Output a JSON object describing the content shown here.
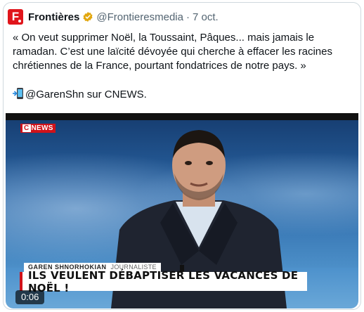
{
  "tweet": {
    "author_name": "Frontières",
    "handle": "@Frontieresmedia",
    "separator": "·",
    "date": "7 oct.",
    "logo_letter": "F",
    "text_line1": "« On veut supprimer Noël, la Toussaint, Pâques... mais jamais le ramadan. C’est une laïcité dévoyée qui cherche à effacer les racines chrétiennes de la France, pourtant fondatrices de notre pays. »",
    "text_line2": "@GarenShn sur CNEWS.",
    "accent_color": "#e0151b",
    "verified_color": "#e2a70f"
  },
  "video": {
    "channel_logo": "NEWS",
    "channel_logo_c": "C",
    "person_name": "GAREN SHNORHOKIAN",
    "person_role": "JOURNALISTE",
    "headline": "ILS VEULENT DÉBAPTISER LES VACANCES DE NOËL !",
    "duration": "0:06"
  }
}
